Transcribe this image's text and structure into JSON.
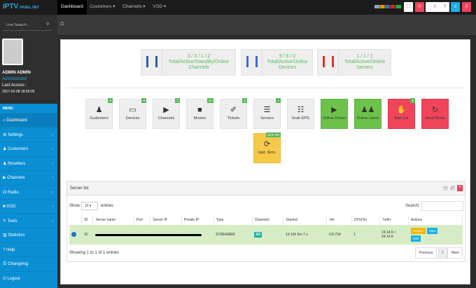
{
  "header": {
    "logo": "IPTV",
    "logo_sub": "PANEL.NET",
    "nav": [
      {
        "label": "Dashboard"
      },
      {
        "label": "Customers ▾"
      },
      {
        "label": "Channels ▾"
      },
      {
        "label": "VOD ▾"
      }
    ],
    "badges": [
      "0",
      "0",
      "0"
    ]
  },
  "sidebar": {
    "search_placeholder": "Live Search ...",
    "user_name": "ADMIN ADMIN",
    "role": "Administrator",
    "last_access_label": "Last Access :",
    "last_access": "2017-02-08 18:56:05",
    "menu_title": "MENU",
    "items": [
      {
        "label": "Dashboard",
        "icon": "⌂"
      },
      {
        "label": "Settings",
        "icon": "⚙"
      },
      {
        "label": "Customers",
        "icon": "♟"
      },
      {
        "label": "Resellers",
        "icon": "♟"
      },
      {
        "label": "Channels",
        "icon": "▶"
      },
      {
        "label": "Radio",
        "icon": "☊"
      },
      {
        "label": "VOD",
        "icon": "■"
      },
      {
        "label": "Tools",
        "icon": "✎"
      },
      {
        "label": "Statistics",
        "icon": "▥"
      },
      {
        "label": "Help",
        "icon": "?"
      },
      {
        "label": "Changelog",
        "icon": "☰"
      },
      {
        "label": "Logout",
        "icon": "⏻"
      }
    ]
  },
  "stats": [
    {
      "value": "3 / 3 / 1 / 2",
      "label": "Total/Active/StandBy/Online Channels"
    },
    {
      "value": "9 / 9 / 0",
      "label": "Total/Active/Online Devices"
    },
    {
      "value": "1 / 1 / 1",
      "label": "Total/Active/Online Servers"
    }
  ],
  "tiles": [
    {
      "label": "Customers",
      "icon": "♟",
      "badge": "0"
    },
    {
      "label": "Devices",
      "icon": "▭",
      "badge": "9"
    },
    {
      "label": "Channels",
      "icon": "▶",
      "badge": "3"
    },
    {
      "label": "Movies",
      "icon": "■",
      "badge": "27"
    },
    {
      "label": "Tickets",
      "icon": "✐",
      "badge": "0"
    },
    {
      "label": "Servers",
      "icon": "☰",
      "badge": "1"
    },
    {
      "label": "Grab EPG",
      "icon": "☷"
    },
    {
      "label": "Online Chann",
      "icon": "▶"
    },
    {
      "label": "Online Users",
      "icon": "♟♟"
    },
    {
      "label": "Ban List",
      "icon": "✋",
      "badge": "0"
    },
    {
      "label": "Hard Reset",
      "icon": "↻"
    },
    {
      "label": "Upd. Strm.",
      "icon": "⟳",
      "badge": "v0.8.754"
    }
  ],
  "server_list": {
    "title": "Server list",
    "show": "Show",
    "entries_value": "10",
    "entries": "entries",
    "search_label": "Search:",
    "columns": [
      "ID",
      "Server name",
      "Port",
      "Server IP",
      "Private IP",
      "Type",
      "Channels",
      "Started",
      "Ver",
      "CPU(%)",
      "Tx/Rx",
      "Actions"
    ],
    "row": {
      "id": "15",
      "type": "STREAMER",
      "channels": "3/3",
      "started": "1d 10h 6m 7 s",
      "ver": "0.8.754",
      "cpu": "1",
      "tx": "24.14 K /",
      "rx": "24.14 K",
      "restart": "Restart",
      "view": "View",
      "edit": "Edit"
    },
    "info": "Showing 1 to 1 of 1 entries",
    "prev": "Previous",
    "page": "1",
    "next": "Next"
  }
}
